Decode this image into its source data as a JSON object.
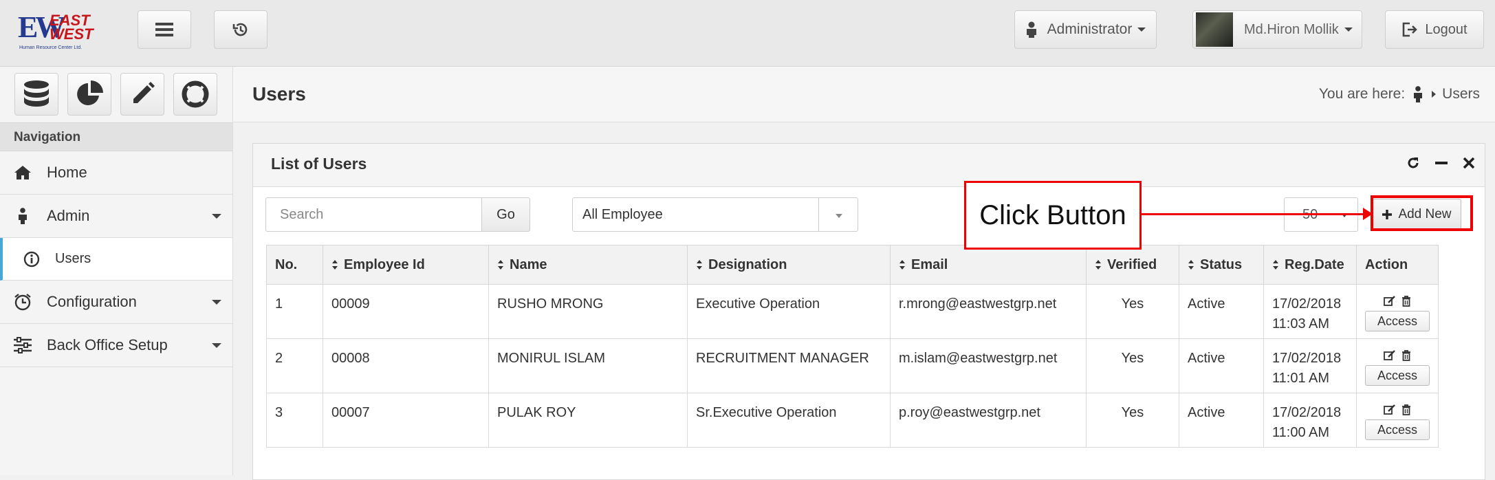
{
  "header": {
    "logo_text": "EW",
    "logo_east": "EAST",
    "logo_west": "WEST",
    "logo_sub": "Human Resource Center Ltd.",
    "role_label": "Administrator",
    "user_name": "Md.Hiron Mollik",
    "logout_label": "Logout"
  },
  "sidebar": {
    "nav_heading": "Navigation",
    "items": [
      {
        "label": "Home"
      },
      {
        "label": "Admin"
      },
      {
        "label": "Users"
      },
      {
        "label": "Configuration"
      },
      {
        "label": "Back Office Setup"
      }
    ]
  },
  "page": {
    "title": "Users",
    "breadcrumb_prefix": "You are here:",
    "breadcrumb_current": "Users"
  },
  "panel": {
    "title": "List of Users",
    "search_placeholder": "Search",
    "go_label": "Go",
    "filter_value": "All Employee",
    "page_size": "50",
    "add_new_label": "Add New"
  },
  "callout": {
    "text": "Click Button",
    "color": "#e00000"
  },
  "table": {
    "columns": [
      "No.",
      "Employee Id",
      "Name",
      "Designation",
      "Email",
      "Verified",
      "Status",
      "Reg.Date",
      "Action"
    ],
    "rows": [
      {
        "no": "1",
        "emp_id": "00009",
        "name": "RUSHO MRONG",
        "designation": "Executive Operation",
        "email": "r.mrong@eastwestgrp.net",
        "verified": "Yes",
        "status": "Active",
        "date": "17/02/2018",
        "time": "11:03 AM",
        "access": "Access"
      },
      {
        "no": "2",
        "emp_id": "00008",
        "name": "MONIRUL ISLAM",
        "designation": "RECRUITMENT MANAGER",
        "email": "m.islam@eastwestgrp.net",
        "verified": "Yes",
        "status": "Active",
        "date": "17/02/2018",
        "time": "11:01 AM",
        "access": "Access"
      },
      {
        "no": "3",
        "emp_id": "00007",
        "name": "PULAK ROY",
        "designation": "Sr.Executive Operation",
        "email": "p.roy@eastwestgrp.net",
        "verified": "Yes",
        "status": "Active",
        "date": "17/02/2018",
        "time": "11:00 AM",
        "access": "Access"
      }
    ]
  }
}
